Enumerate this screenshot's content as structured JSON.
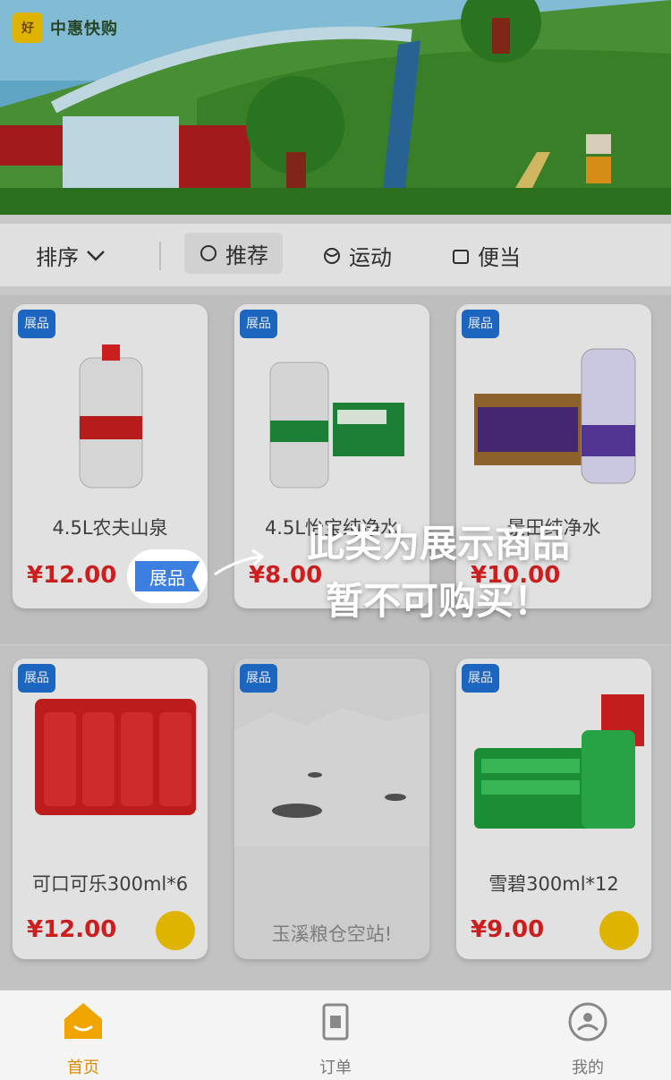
{
  "app": {
    "logo_mark": "好",
    "logo_text": "中惠快购",
    "logo_sub": ""
  },
  "filters": {
    "sort_label": "排序",
    "tag_a": "推荐",
    "tag_b": "运动",
    "tag_c": "便当"
  },
  "products": [
    {
      "badge": "展品",
      "name": "4.5L农夫山泉",
      "price": "¥12.00",
      "has_cart": false
    },
    {
      "badge": "展品",
      "name": "4.5L怡宝纯净水",
      "price": "¥8.00",
      "has_cart": false
    },
    {
      "badge": "展品",
      "name": "景田纯净水",
      "price": "¥10.00",
      "has_cart": false
    },
    {
      "badge": "展品",
      "name": "可口可乐300ml*6",
      "price": "¥12.00",
      "has_cart": true
    },
    {
      "badge": "展品",
      "name": "玉溪粮仓空站!",
      "price": "",
      "has_cart": false
    },
    {
      "badge": "展品",
      "name": "雪碧300ml*12",
      "price": "¥9.00",
      "has_cart": true
    }
  ],
  "notice": {
    "tag": "展品",
    "line1": "此类为展示商品",
    "line2": "暂不可购买！"
  },
  "tabs": [
    {
      "label": "首页",
      "icon": "home-icon",
      "active": true
    },
    {
      "label": "订单",
      "icon": "order-icon",
      "active": false
    },
    {
      "label": "我的",
      "icon": "profile-icon",
      "active": false
    }
  ],
  "colors": {
    "accent": "#f2c400",
    "price": "#dd2222",
    "badge": "#1f6fd0",
    "notice_tag": "#3d7fe0"
  }
}
